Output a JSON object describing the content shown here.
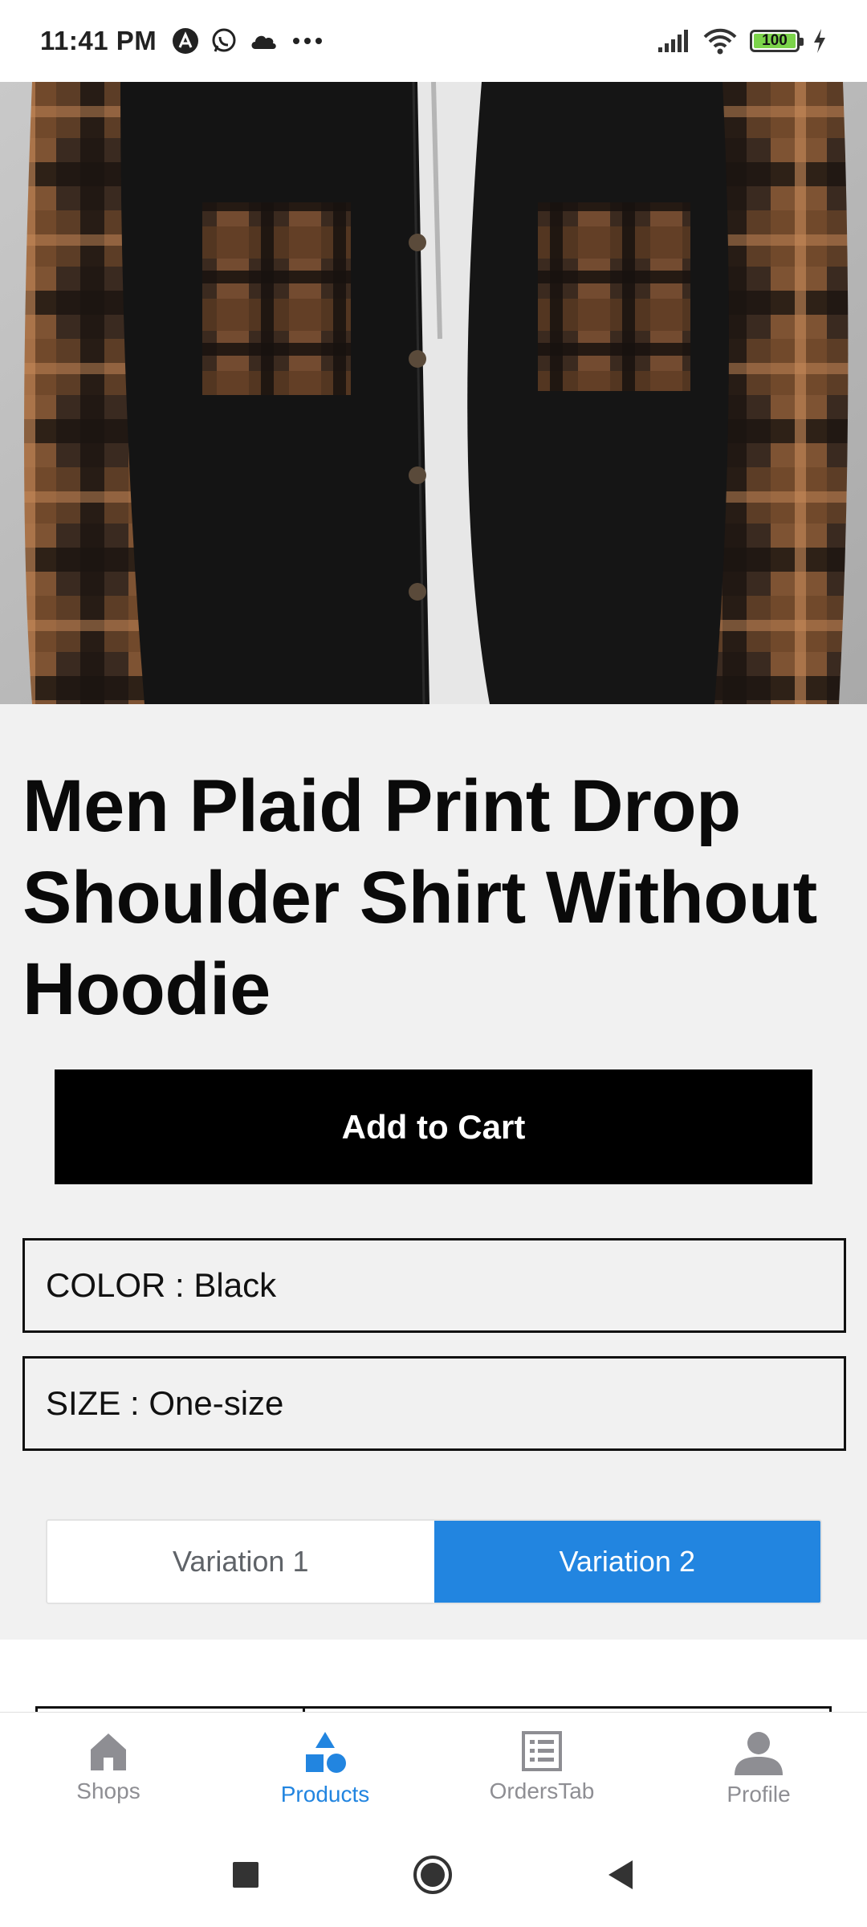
{
  "status_bar": {
    "time": "11:41 PM",
    "battery": "100",
    "left_icons": [
      "app-a-icon",
      "whatsapp-icon",
      "cloud-icon",
      "more-dots-icon"
    ],
    "right_icons": [
      "signal-icon",
      "wifi-icon",
      "battery-icon",
      "charging-icon"
    ]
  },
  "product": {
    "image_alt": "plaid shirt photo",
    "title": "Men Plaid Print Drop Shoulder Shirt Without Hoodie",
    "add_to_cart_label": "Add to Cart",
    "color_label": "COLOR : Black",
    "size_label": "SIZE : One-size",
    "variations": [
      {
        "label": "Variation 1",
        "selected": false
      },
      {
        "label": "Variation 2",
        "selected": true
      }
    ]
  },
  "tabs": [
    {
      "label": "Shops",
      "icon": "home-icon",
      "active": false
    },
    {
      "label": "Products",
      "icon": "shapes-icon",
      "active": true
    },
    {
      "label": "OrdersTab",
      "icon": "list-icon",
      "active": false
    },
    {
      "label": "Profile",
      "icon": "person-icon",
      "active": false
    }
  ],
  "colors": {
    "accent": "#2285e0",
    "inactive_tab": "#8e8e93",
    "button": "#000000",
    "details_bg": "#f1f1f1"
  },
  "nav_bar": [
    "recents-square-icon",
    "home-circle-icon",
    "back-triangle-icon"
  ]
}
